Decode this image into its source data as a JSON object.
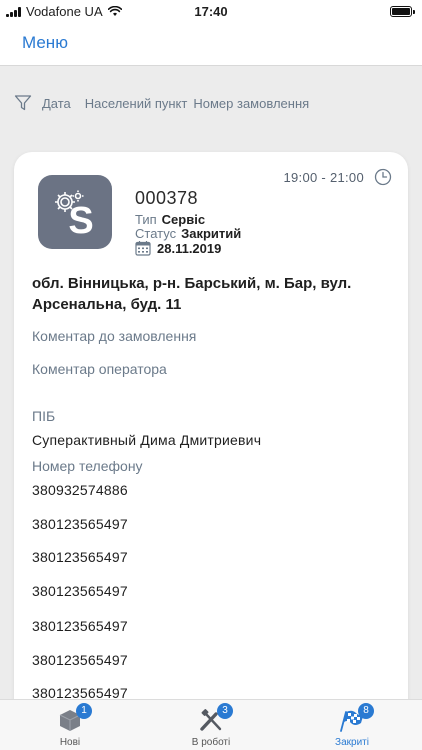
{
  "status_bar": {
    "carrier": "Vodafone UA",
    "time": "17:40"
  },
  "nav": {
    "menu_label": "Меню"
  },
  "filters": {
    "items": [
      "Дата",
      "Населений пункт",
      "Номер замовлення"
    ]
  },
  "order": {
    "number": "000378",
    "type_key": "Тип",
    "type_value": "Сервіс",
    "status_key": "Статус",
    "status_value": "Закритий",
    "date": "28.11.2019",
    "time_range": "19:00 - 21:00",
    "address": "обл. Вінницька, р-н. Барський, м. Бар, вул. Арсенальна, буд. 11",
    "order_comment_label": "Коментар до замовлення",
    "operator_comment_label": "Коментар оператора",
    "name_label": "ПІБ",
    "name_value": "Суперактивный Дима Дмитриевич",
    "phone_label": "Номер телефону",
    "phones": [
      "380932574886",
      "380123565497",
      "380123565497",
      "380123565497",
      "380123565497",
      "380123565497",
      "380123565497"
    ]
  },
  "tabs": [
    {
      "label": "Нові",
      "badge": "1",
      "icon": "box-icon"
    },
    {
      "label": "В роботі",
      "badge": "3",
      "icon": "tools-icon"
    },
    {
      "label": "Закриті",
      "badge": "8",
      "icon": "checkered-flag-icon"
    }
  ],
  "colors": {
    "accent": "#2a7ad2",
    "avatar_bg": "#6b7384",
    "page_bg": "#ececec"
  }
}
